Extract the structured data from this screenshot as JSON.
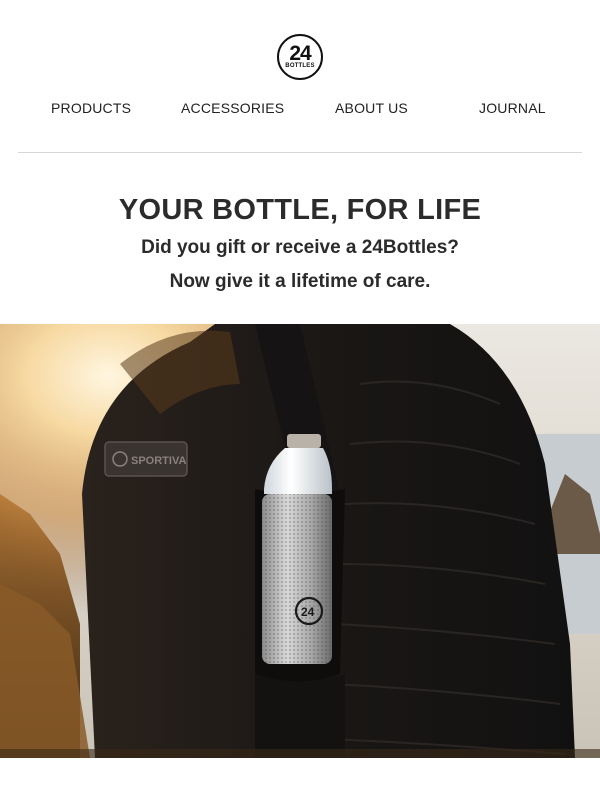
{
  "brand": {
    "logo_number": "24",
    "logo_word": "BOTTLES"
  },
  "nav": {
    "items": [
      {
        "label": "PRODUCTS"
      },
      {
        "label": "ACCESSORIES"
      },
      {
        "label": "ABOUT US"
      },
      {
        "label": "JOURNAL"
      }
    ]
  },
  "hero_text": {
    "headline": "YOUR BOTTLE, FOR LIFE",
    "line1": "Did you gift or receive a 24Bottles?",
    "line2": "Now give it a lifetime of care."
  },
  "hero_image": {
    "patch_text": "SPORTIVA",
    "bottle_logo_number": "24"
  }
}
